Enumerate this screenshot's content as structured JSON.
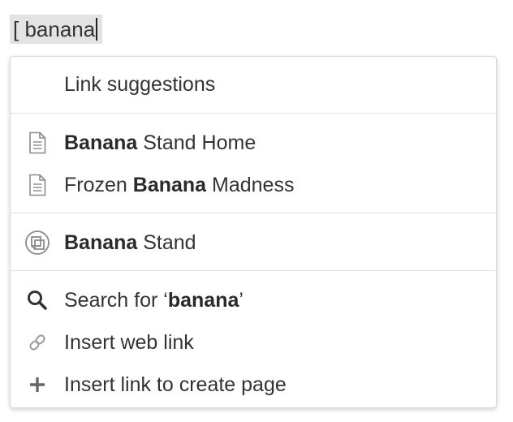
{
  "editor": {
    "input_text": "[ banana"
  },
  "popup": {
    "header": "Link suggestions",
    "pages": [
      {
        "icon": "document-icon",
        "bold": "Banana",
        "after": " Stand Home",
        "before": ""
      },
      {
        "icon": "document-icon",
        "before": "Frozen ",
        "bold": "Banana",
        "after": " Madness"
      }
    ],
    "spaces": [
      {
        "icon": "space-logo-icon",
        "before": "",
        "bold": "Banana",
        "after": " Stand"
      }
    ],
    "actions": {
      "search": {
        "icon": "search-icon",
        "before": "Search for ‘",
        "bold": "banana",
        "after": "’"
      },
      "web_link": {
        "icon": "link-icon",
        "label": "Insert web link"
      },
      "create_page": {
        "icon": "plus-icon",
        "label": "Insert link to create page"
      }
    }
  }
}
